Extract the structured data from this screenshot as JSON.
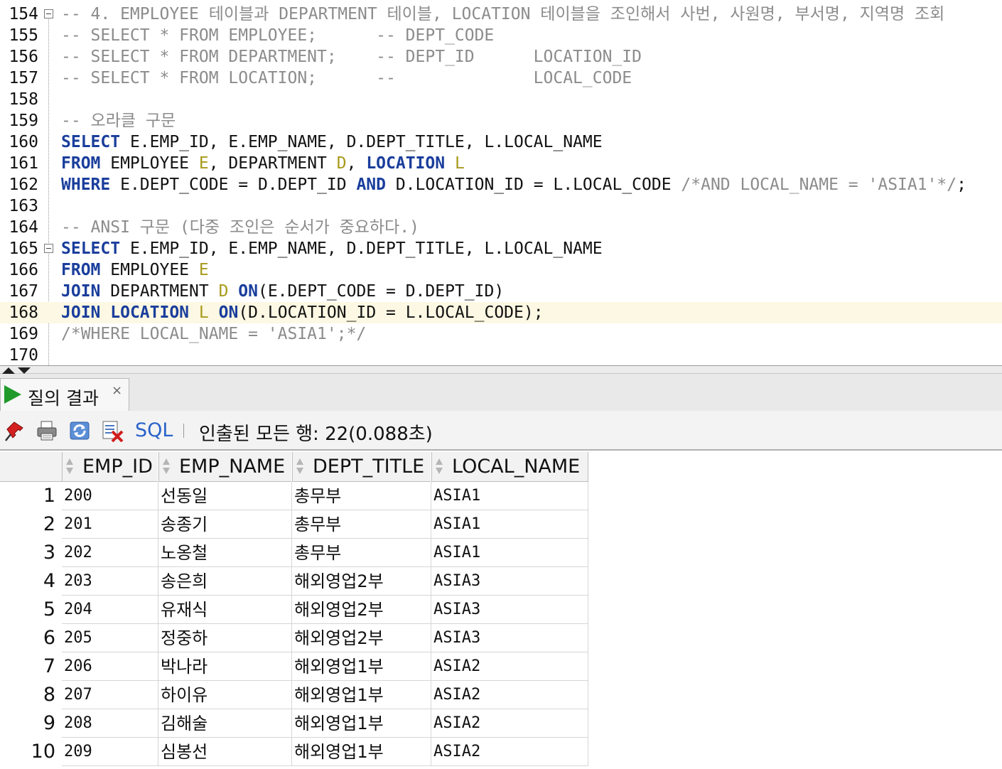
{
  "editor": {
    "lines": [
      {
        "no": "154",
        "fold": true,
        "segments": [
          {
            "t": "-- 4. EMPLOYEE 테이블과 DEPARTMENT 테이블, LOCATION 테이블을 조인해서 사번, 사원명, 부서명, 지역명 조회",
            "c": "cm"
          }
        ]
      },
      {
        "no": "155",
        "fold": false,
        "segments": [
          {
            "t": "-- SELECT * FROM EMPLOYEE;      -- DEPT_CODE",
            "c": "cm"
          }
        ]
      },
      {
        "no": "156",
        "fold": false,
        "segments": [
          {
            "t": "-- SELECT * FROM DEPARTMENT;    -- DEPT_ID      LOCATION_ID",
            "c": "cm"
          }
        ]
      },
      {
        "no": "157",
        "fold": false,
        "segments": [
          {
            "t": "-- SELECT * FROM LOCATION;      --              LOCAL_CODE",
            "c": "cm"
          }
        ]
      },
      {
        "no": "158",
        "fold": false,
        "segments": []
      },
      {
        "no": "159",
        "fold": false,
        "segments": [
          {
            "t": "-- 오라클 구문",
            "c": "cm"
          }
        ]
      },
      {
        "no": "160",
        "fold": false,
        "segments": [
          {
            "t": "SELECT",
            "c": "kw"
          },
          {
            "t": " E.EMP_ID, E.EMP_NAME, D.DEPT_TITLE, L.LOCAL_NAME",
            "c": ""
          }
        ]
      },
      {
        "no": "161",
        "fold": false,
        "segments": [
          {
            "t": "FROM",
            "c": "kw"
          },
          {
            "t": " EMPLOYEE ",
            "c": ""
          },
          {
            "t": "E",
            "c": "al"
          },
          {
            "t": ", DEPARTMENT ",
            "c": ""
          },
          {
            "t": "D",
            "c": "al"
          },
          {
            "t": ", ",
            "c": ""
          },
          {
            "t": "LOCATION",
            "c": "kw"
          },
          {
            "t": " ",
            "c": ""
          },
          {
            "t": "L",
            "c": "al"
          }
        ]
      },
      {
        "no": "162",
        "fold": false,
        "segments": [
          {
            "t": "WHERE",
            "c": "kw"
          },
          {
            "t": " E.DEPT_CODE = D.DEPT_ID ",
            "c": ""
          },
          {
            "t": "AND",
            "c": "kw"
          },
          {
            "t": " D.LOCATION_ID = L.LOCAL_CODE ",
            "c": ""
          },
          {
            "t": "/*AND LOCAL_NAME = 'ASIA1'*/",
            "c": "cm"
          },
          {
            "t": ";",
            "c": ""
          }
        ]
      },
      {
        "no": "163",
        "fold": false,
        "segments": []
      },
      {
        "no": "164",
        "fold": false,
        "segments": [
          {
            "t": "-- ANSI 구문 (다중 조인은 순서가 중요하다.)",
            "c": "cm"
          }
        ]
      },
      {
        "no": "165",
        "fold": true,
        "segments": [
          {
            "t": "SELECT",
            "c": "kw"
          },
          {
            "t": " E.EMP_ID, E.EMP_NAME, D.DEPT_TITLE, L.LOCAL_NAME",
            "c": ""
          }
        ]
      },
      {
        "no": "166",
        "fold": false,
        "segments": [
          {
            "t": "FROM",
            "c": "kw"
          },
          {
            "t": " EMPLOYEE ",
            "c": ""
          },
          {
            "t": "E",
            "c": "al"
          }
        ]
      },
      {
        "no": "167",
        "fold": false,
        "segments": [
          {
            "t": "JOIN",
            "c": "kw"
          },
          {
            "t": " DEPARTMENT ",
            "c": ""
          },
          {
            "t": "D",
            "c": "al"
          },
          {
            "t": " ",
            "c": ""
          },
          {
            "t": "ON",
            "c": "kw"
          },
          {
            "t": "(E.DEPT_CODE = D.DEPT_ID)",
            "c": ""
          }
        ]
      },
      {
        "no": "168",
        "fold": false,
        "current": true,
        "segments": [
          {
            "t": "JOIN",
            "c": "kw"
          },
          {
            "t": " ",
            "c": ""
          },
          {
            "t": "LOCATION",
            "c": "kw"
          },
          {
            "t": " ",
            "c": ""
          },
          {
            "t": "L",
            "c": "al"
          },
          {
            "t": " ",
            "c": ""
          },
          {
            "t": "ON",
            "c": "kw"
          },
          {
            "t": "(D.LOCATION_ID = L.LOCAL_CODE);",
            "c": ""
          }
        ]
      },
      {
        "no": "169",
        "fold": false,
        "segments": [
          {
            "t": "/*WHERE LOCAL_NAME = 'ASIA1';*/",
            "c": "cm"
          }
        ]
      },
      {
        "no": "170",
        "fold": false,
        "segments": []
      }
    ]
  },
  "results": {
    "tab_label": "질의 결과",
    "tab_close": "×",
    "toolbar": {
      "icons": [
        "pin-icon",
        "print-icon",
        "refresh-icon",
        "cancel-query-icon"
      ],
      "sql_label": "SQL",
      "status": "인출된 모든 행: 22(0.088초)"
    },
    "columns": [
      "EMP_ID",
      "EMP_NAME",
      "DEPT_TITLE",
      "LOCAL_NAME"
    ],
    "rows": [
      {
        "no": "1",
        "cells": [
          "200",
          "선동일",
          "총무부",
          "ASIA1"
        ]
      },
      {
        "no": "2",
        "cells": [
          "201",
          "송종기",
          "총무부",
          "ASIA1"
        ]
      },
      {
        "no": "3",
        "cells": [
          "202",
          "노옹철",
          "총무부",
          "ASIA1"
        ]
      },
      {
        "no": "4",
        "cells": [
          "203",
          "송은희",
          "해외영업2부",
          "ASIA3"
        ]
      },
      {
        "no": "5",
        "cells": [
          "204",
          "유재식",
          "해외영업2부",
          "ASIA3"
        ]
      },
      {
        "no": "6",
        "cells": [
          "205",
          "정중하",
          "해외영업2부",
          "ASIA3"
        ]
      },
      {
        "no": "7",
        "cells": [
          "206",
          "박나라",
          "해외영업1부",
          "ASIA2"
        ]
      },
      {
        "no": "8",
        "cells": [
          "207",
          "하이유",
          "해외영업1부",
          "ASIA2"
        ]
      },
      {
        "no": "9",
        "cells": [
          "208",
          "김해술",
          "해외영업1부",
          "ASIA2"
        ]
      },
      {
        "no": "10",
        "cells": [
          "209",
          "심봉선",
          "해외영업1부",
          "ASIA2"
        ]
      }
    ]
  },
  "colors": {
    "keyword": "#1a3e9c",
    "alias": "#a89a1a",
    "comment": "#8c8c8c",
    "current_line": "#fdf8e3",
    "sql_link": "#2a62c9",
    "run_icon": "#1f9a2b"
  }
}
